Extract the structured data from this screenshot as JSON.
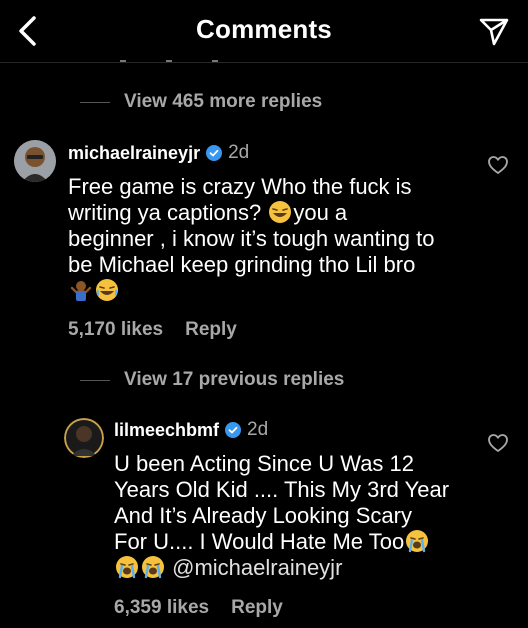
{
  "header": {
    "title": "Comments"
  },
  "thread1": {
    "view_more": "View 465 more replies",
    "comment": {
      "username": "michaelraineyjr",
      "time": "2d",
      "line1": "Free game is crazy Who the fuck is",
      "line2a": "writing ya captions? ",
      "line2b": "you a",
      "line3": "beginner , i know it’s tough wanting to",
      "line4": "be Michael keep grinding tho Lil bro",
      "likes": "5,170 likes",
      "reply": "Reply"
    }
  },
  "thread2": {
    "view_previous": "View 17 previous replies",
    "comment": {
      "username": "lilmeechbmf",
      "time": "2d",
      "line1": "U been Acting Since U Was 12",
      "line2": "Years Old Kid .... This My 3rd Year",
      "line3": "And It’s Already Looking Scary",
      "line4": "For U.... I Would Hate Me Too",
      "mention": "@michaelraineyjr",
      "likes": "6,359 likes",
      "reply": "Reply"
    }
  },
  "colors": {
    "background": "#000000",
    "secondary_text": "#a8a8a8",
    "verified": "#3897f0"
  },
  "icons": [
    "back-arrow-icon",
    "send-icon",
    "verified-badge-icon",
    "heart-icon",
    "laughing-emoji",
    "crying-emoji",
    "shrug-emoji"
  ]
}
